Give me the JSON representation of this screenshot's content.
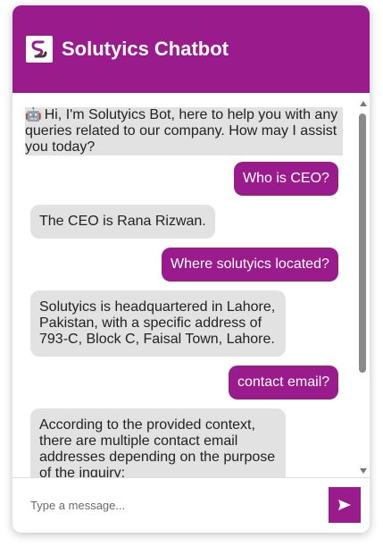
{
  "header": {
    "title": "Solutyics Chatbot",
    "accent_color": "#9a1b8c",
    "logo_icon": "solutyics-logo"
  },
  "messages": [
    {
      "sender": "bot",
      "emoji": "🤖",
      "text": "Hi, I'm Solutyics Bot, here to help you with any queries related to our company. How may I assist you today?"
    },
    {
      "sender": "user",
      "text": "Who is CEO?"
    },
    {
      "sender": "bot",
      "text": "The CEO is Rana Rizwan."
    },
    {
      "sender": "user",
      "text": "Where solutyics located?"
    },
    {
      "sender": "bot",
      "text": "Solutyics is headquartered in Lahore, Pakistan, with a specific address of 793-C, Block C, Faisal Town, Lahore."
    },
    {
      "sender": "user",
      "text": "contact email?"
    },
    {
      "sender": "bot",
      "text": "According to the provided context, there are multiple contact email addresses depending on the purpose of the inquiry:"
    }
  ],
  "composer": {
    "placeholder": "Type a message...",
    "send_icon": "send-arrow-icon"
  }
}
